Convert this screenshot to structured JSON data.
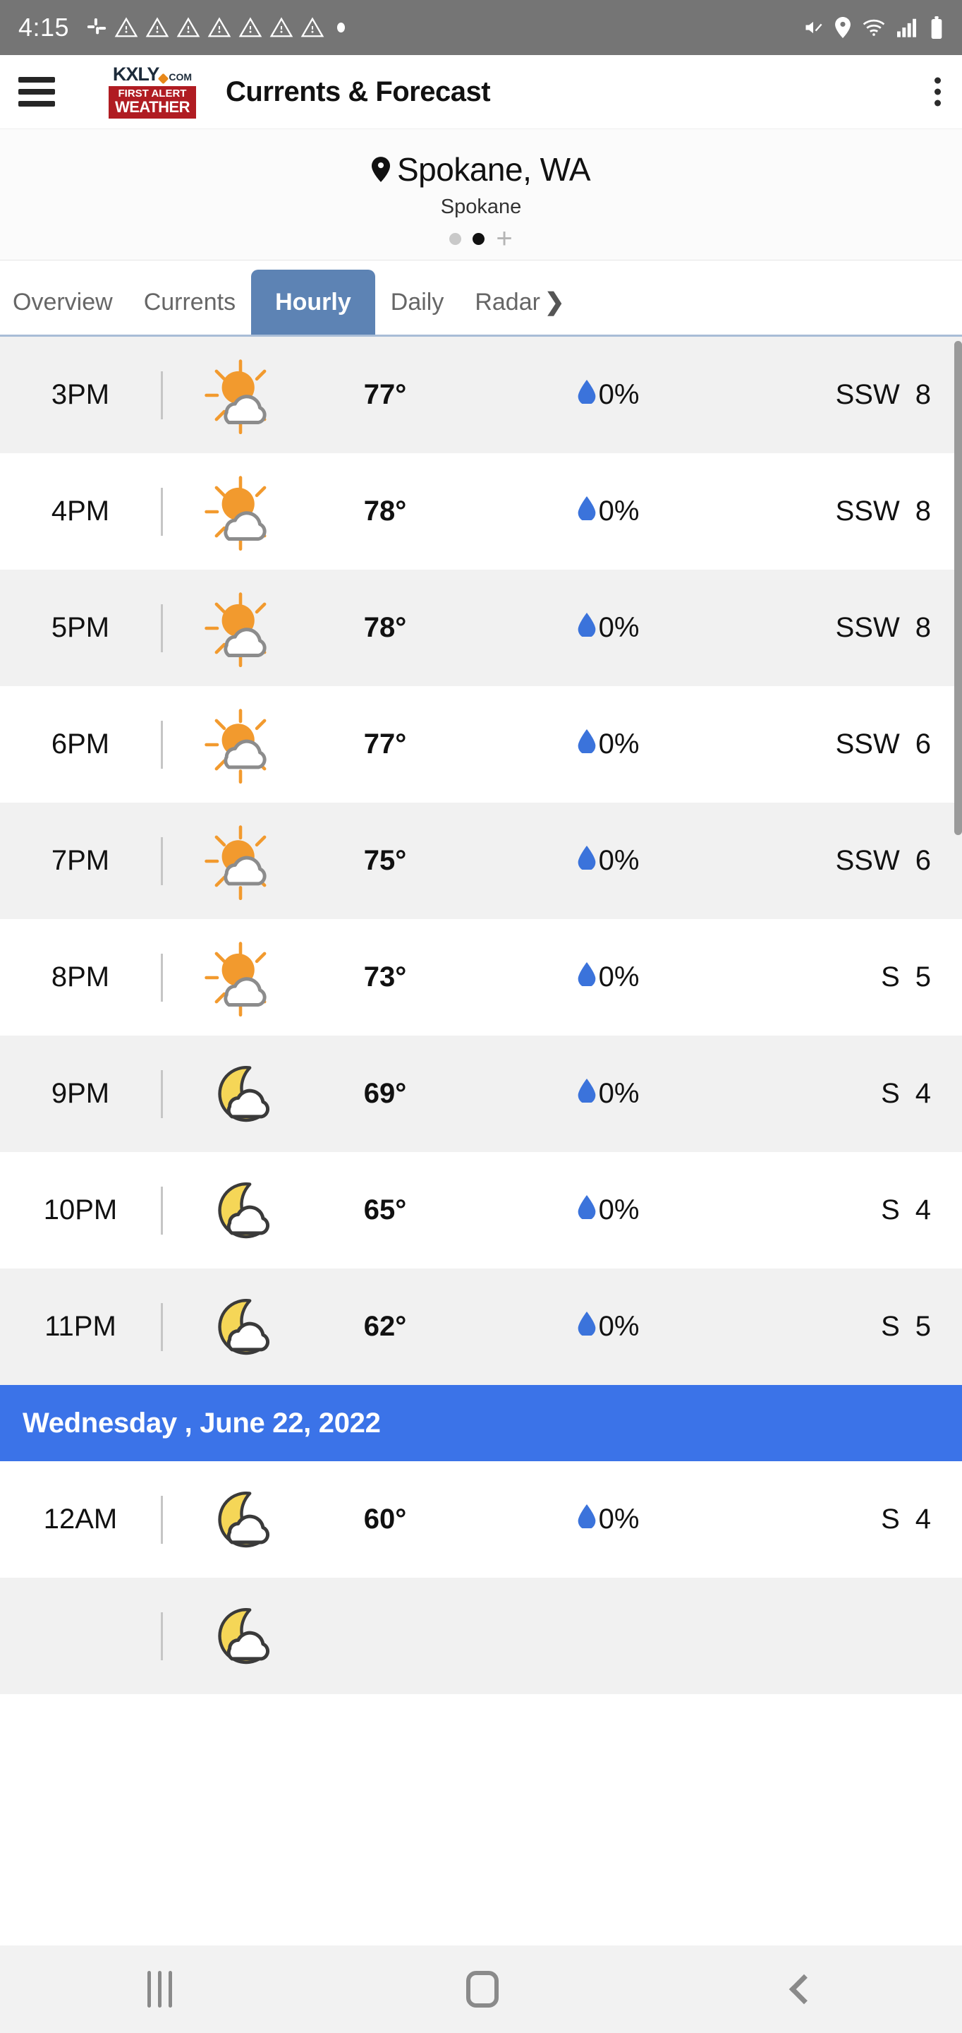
{
  "status_bar": {
    "time": "4:15",
    "icons": [
      "slack-icon",
      "warning-icon",
      "warning-icon",
      "warning-icon",
      "warning-icon",
      "warning-icon",
      "warning-icon",
      "warning-icon",
      "dot-icon"
    ],
    "right_icons": [
      "mute-icon",
      "location-icon",
      "wifi-icon",
      "signal-icon",
      "battery-icon"
    ]
  },
  "app_bar": {
    "menu_icon": "hamburger-icon",
    "logo": {
      "brand": "KXLY",
      "domain": "COM",
      "line1a": "FIRST ",
      "line1b": "ALERT",
      "line2": "WEATHER"
    },
    "title": "Currents & Forecast",
    "overflow_icon": "kebab-menu-icon"
  },
  "location": {
    "pin_icon": "location-pin-icon",
    "city_state": "Spokane, WA",
    "region": "Spokane",
    "pager": {
      "count": 2,
      "active_index": 1,
      "add_label": "+"
    }
  },
  "tabs": {
    "items": [
      {
        "label": "Overview",
        "active": false
      },
      {
        "label": "Currents",
        "active": false
      },
      {
        "label": "Hourly",
        "active": true
      },
      {
        "label": "Daily",
        "active": false
      },
      {
        "label": "Radar",
        "active": false,
        "chevron": "❯"
      }
    ],
    "active_color": "#5d83b4"
  },
  "hourly": {
    "colors": {
      "sun": "#F29A2E",
      "moon": "#F5D657",
      "cloud": "#FFFFFF",
      "cloud_outline_day": "#8C8C8C",
      "cloud_outline_night": "#3A3A3A",
      "droplet": "#3B73DB",
      "date_bar": "#3b73e8"
    },
    "rows": [
      {
        "time": "3PM",
        "icon": "sun-behind-cloud-icon",
        "temp": "77°",
        "precip": "0%",
        "wind_dir": "SSW",
        "wind_speed": "8"
      },
      {
        "time": "4PM",
        "icon": "sun-behind-cloud-icon",
        "temp": "78°",
        "precip": "0%",
        "wind_dir": "SSW",
        "wind_speed": "8"
      },
      {
        "time": "5PM",
        "icon": "sun-behind-cloud-icon",
        "temp": "78°",
        "precip": "0%",
        "wind_dir": "SSW",
        "wind_speed": "8"
      },
      {
        "time": "6PM",
        "icon": "mostly-cloudy-day-icon",
        "temp": "77°",
        "precip": "0%",
        "wind_dir": "SSW",
        "wind_speed": "6"
      },
      {
        "time": "7PM",
        "icon": "mostly-cloudy-day-icon",
        "temp": "75°",
        "precip": "0%",
        "wind_dir": "SSW",
        "wind_speed": "6"
      },
      {
        "time": "8PM",
        "icon": "sun-behind-cloud-icon",
        "temp": "73°",
        "precip": "0%",
        "wind_dir": "S",
        "wind_speed": "5"
      },
      {
        "time": "9PM",
        "icon": "moon-behind-cloud-icon",
        "temp": "69°",
        "precip": "0%",
        "wind_dir": "S",
        "wind_speed": "4"
      },
      {
        "time": "10PM",
        "icon": "moon-behind-cloud-icon",
        "temp": "65°",
        "precip": "0%",
        "wind_dir": "S",
        "wind_speed": "4"
      },
      {
        "time": "11PM",
        "icon": "moon-behind-cloud-icon",
        "temp": "62°",
        "precip": "0%",
        "wind_dir": "S",
        "wind_speed": "5"
      }
    ],
    "date_divider": "Wednesday , June 22, 2022",
    "rows_after": [
      {
        "time": "12AM",
        "icon": "moon-behind-cloud-icon",
        "temp": "60°",
        "precip": "0%",
        "wind_dir": "S",
        "wind_speed": "4"
      }
    ]
  },
  "nav_bar": {
    "recents_label": "recents-icon",
    "home_label": "home-icon",
    "back_label": "back-icon"
  }
}
